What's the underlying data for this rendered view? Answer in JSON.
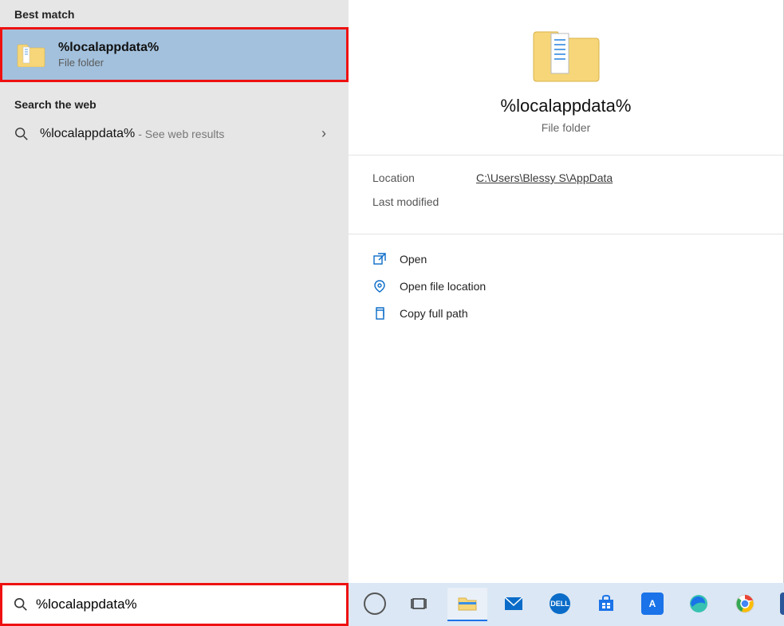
{
  "sections": {
    "best_match_header": "Best match",
    "search_web_header": "Search the web"
  },
  "best_match": {
    "title": "%localappdata%",
    "subtitle": "File folder"
  },
  "web_result": {
    "query": "%localappdata%",
    "hint": " - See web results"
  },
  "preview": {
    "title": "%localappdata%",
    "subtitle": "File folder",
    "meta": {
      "location_label": "Location",
      "location_value": "C:\\Users\\Blessy S\\AppData",
      "last_modified_label": "Last modified",
      "last_modified_value": ""
    },
    "actions": {
      "open": "Open",
      "open_location": "Open file location",
      "copy_path": "Copy full path"
    }
  },
  "search_input": {
    "value": "%localappdata%"
  },
  "taskbar": {
    "items": [
      {
        "name": "cortana-icon"
      },
      {
        "name": "task-view-icon"
      },
      {
        "name": "file-explorer-icon"
      },
      {
        "name": "mail-icon"
      },
      {
        "name": "dell-icon"
      },
      {
        "name": "store-icon"
      },
      {
        "name": "ad-icon"
      },
      {
        "name": "edge-icon"
      },
      {
        "name": "chrome-icon"
      },
      {
        "name": "word-icon"
      }
    ]
  }
}
